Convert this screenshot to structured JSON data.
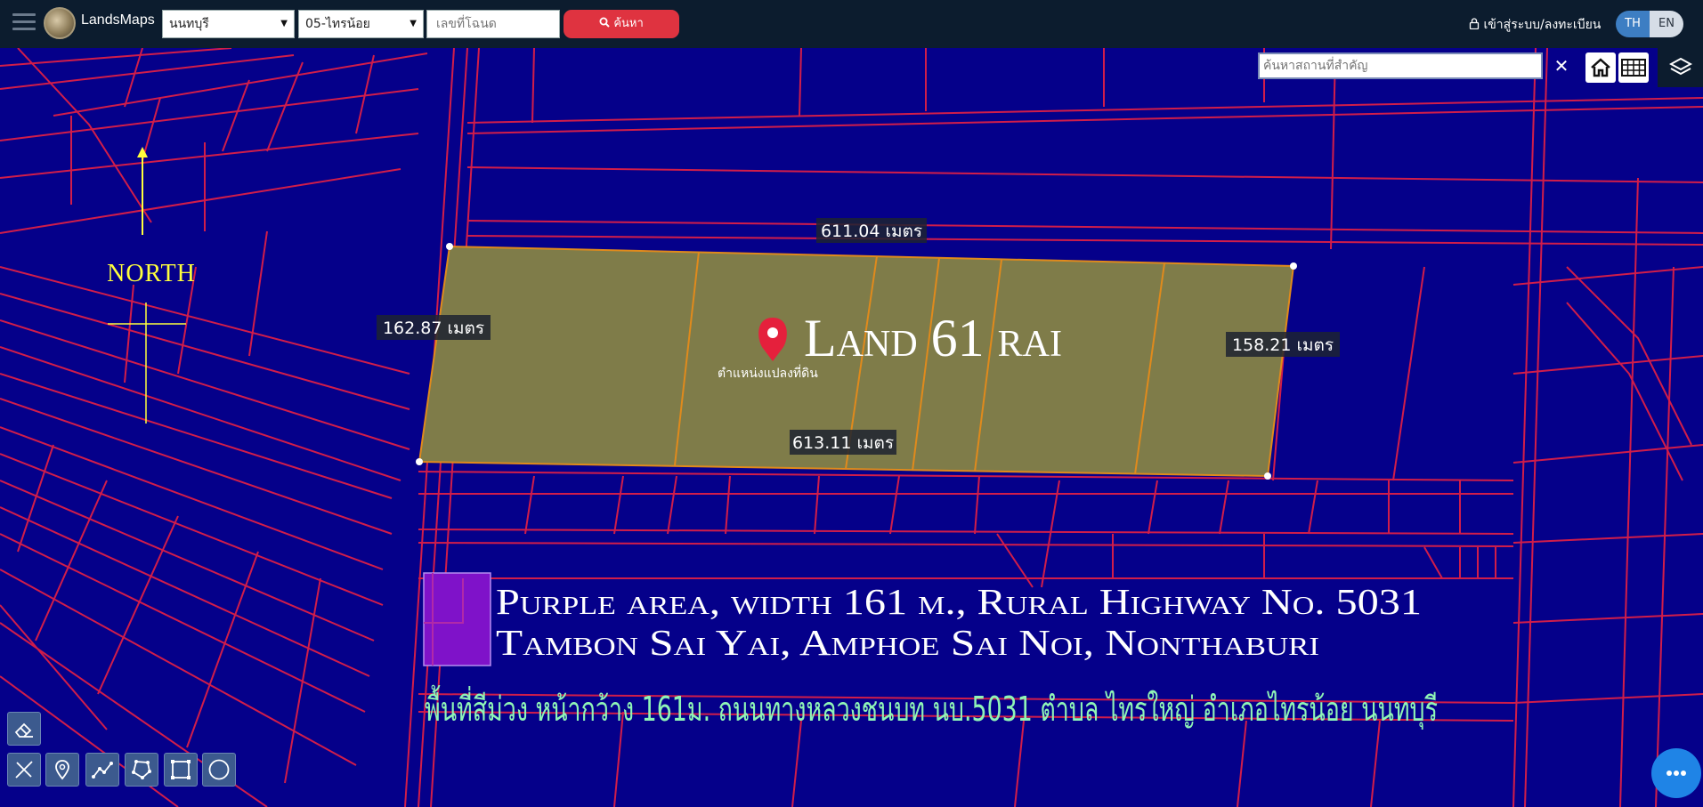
{
  "header": {
    "brand": "LandsMaps",
    "province": "นนทบุรี",
    "district": "05-ไทรน้อย",
    "parcel_placeholder": "เลขที่โฉนด",
    "search_label": "ค้นหา",
    "login_label": "เข้าสู่ระบบ/ลงทะเบียน",
    "lang_th": "TH",
    "lang_en": "EN"
  },
  "map": {
    "place_search_placeholder": "ค้นหาสถานที่สำคัญ",
    "clear_label": "✕",
    "north_label": "NORTH",
    "land_title": "Land 61 rai",
    "pin_caption": "ตำแหน่งแปลงที่ดิน",
    "measurements": {
      "top": "611.04 เมตร",
      "left": "162.87 เมตร",
      "right": "158.21 เมตร",
      "bottom": "613.11 เมตร"
    },
    "legend_line1": "Purple area, width 161 m., Rural Highway No. 5031",
    "legend_line2": "Tambon Sai Yai, Amphoe Sai Noi, Nonthaburi",
    "thai_caption": "พื้นที่สีม่วง หน้ากว้าง 161ม. ถนนทางหลวงชนบท นบ.5031 ตำบล ไทรใหญ่ อำเภอไทรน้อย นนทบุรี",
    "colors": {
      "background": "#05008a",
      "parcel_lines": "#d11d4a",
      "land_fill": "#7f7c49",
      "land_border": "#e08a1c",
      "purple_area": "#7f12c9",
      "north": "#ffff3c",
      "thai_caption": "#8ff5b6",
      "pin": "#e5203c"
    }
  },
  "tools": [
    {
      "icon": "eraser-icon"
    },
    {
      "icon": "ruler-pencil-icon"
    },
    {
      "icon": "location-pin-icon"
    },
    {
      "icon": "polyline-icon"
    },
    {
      "icon": "polygon-icon"
    },
    {
      "icon": "rectangle-icon"
    },
    {
      "icon": "circle-icon"
    }
  ]
}
